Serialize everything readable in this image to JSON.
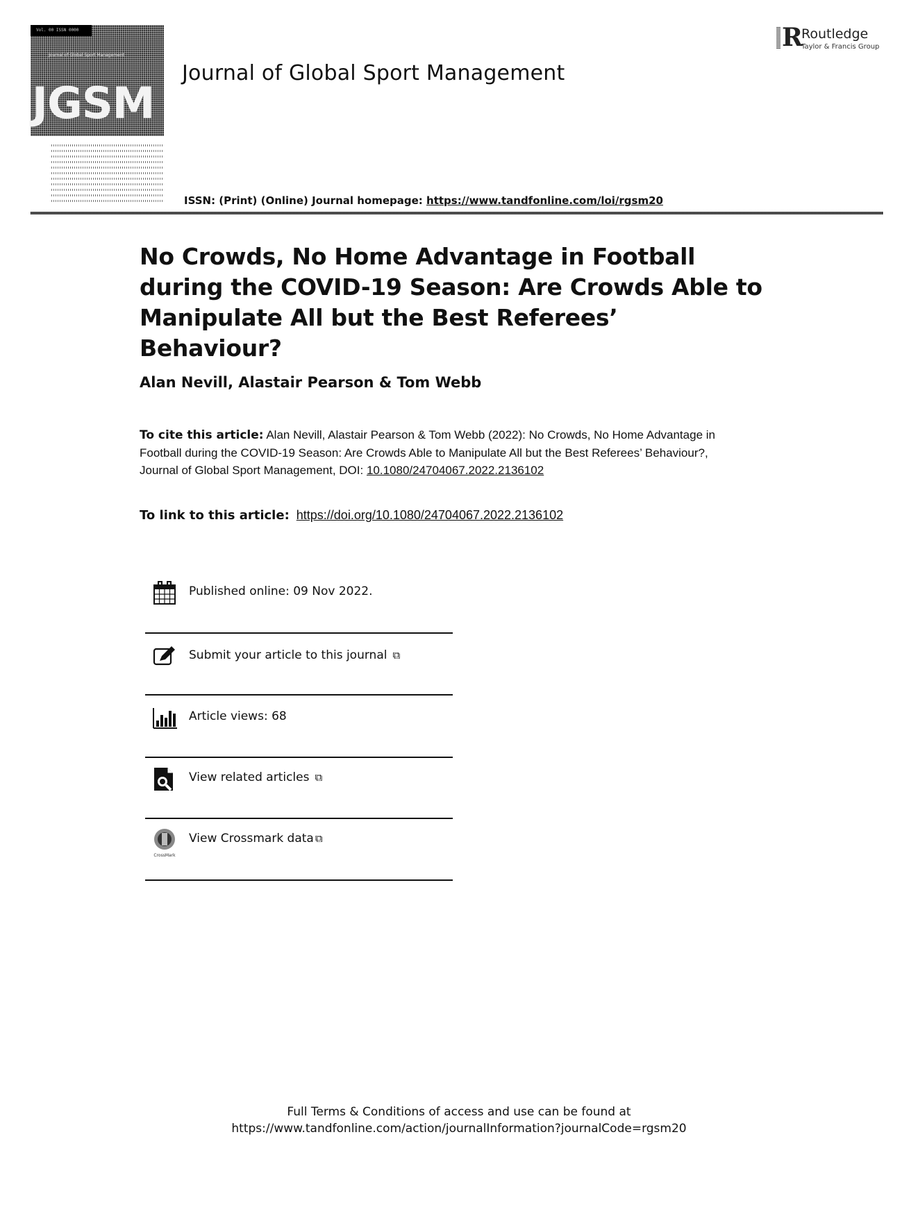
{
  "header": {
    "cover": {
      "acronym": "JGSM",
      "band_text": "Vol. 00  ISSN 0000",
      "subtitle": "Journal of Global Sport Management"
    },
    "journal_title": "Journal of Global Sport Management",
    "publisher": {
      "name": "Routledge",
      "group": "Taylor & Francis Group"
    },
    "issn_line": {
      "label": "ISSN: (Print) (Online) Journal homepage: ",
      "homepage_url": "https://www.tandfonline.com/loi/rgsm20"
    }
  },
  "article": {
    "title_lines": [
      "No Crowds, No Home Advantage in Football",
      "during the COVID-19 Season: Are Crowds Able to",
      "Manipulate All but the Best Referees’ Behaviour?"
    ],
    "authors": "Alan Nevill, Alastair Pearson & Tom Webb",
    "cite": {
      "label": "To cite this article:",
      "text": " Alan Nevill, Alastair Pearson & Tom Webb (2022): No Crowds, No Home Advantage in Football during the COVID-19 Season: Are Crowds Able to Manipulate All but the Best Referees’ Behaviour?, Journal of Global Sport Management, DOI: ",
      "doi": "10.1080/24704067.2022.2136102"
    },
    "link": {
      "label": "To link to this article:",
      "url": "https://doi.org/10.1080/24704067.2022.2136102"
    }
  },
  "meta": {
    "published": "Published online: 09 Nov 2022.",
    "submit": "Submit your article to this journal",
    "views": "Article views: 68",
    "related": "View related articles",
    "crossmark": "View Crossmark data",
    "crossmark_caption": "CrossMark",
    "external_link_glyph": "⧉"
  },
  "footer": {
    "line1": "Full Terms & Conditions of access and use can be found at",
    "line2": "https://www.tandfonline.com/action/journalInformation?journalCode=rgsm20"
  }
}
